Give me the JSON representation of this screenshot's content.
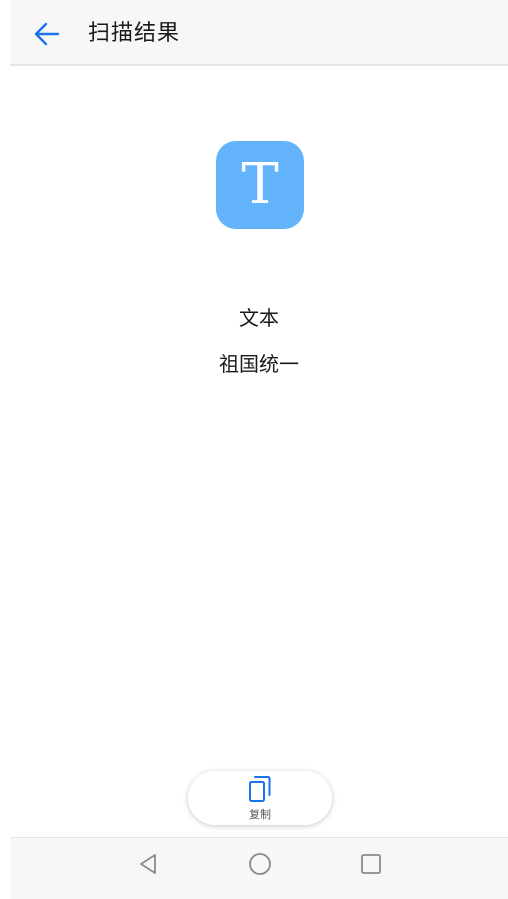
{
  "header": {
    "title": "扫描结果",
    "back_icon": "arrow-left-icon",
    "accent_color": "#1a73e8"
  },
  "result": {
    "type_icon_letter": "T",
    "type_icon_color": "#63b3fb",
    "type_label": "文本",
    "content": "祖国统一"
  },
  "actions": {
    "copy_label": "复制",
    "copy_icon": "copy-icon"
  },
  "navbar": {
    "back_icon": "triangle-back-icon",
    "home_icon": "circle-home-icon",
    "recent_icon": "square-recent-icon"
  }
}
